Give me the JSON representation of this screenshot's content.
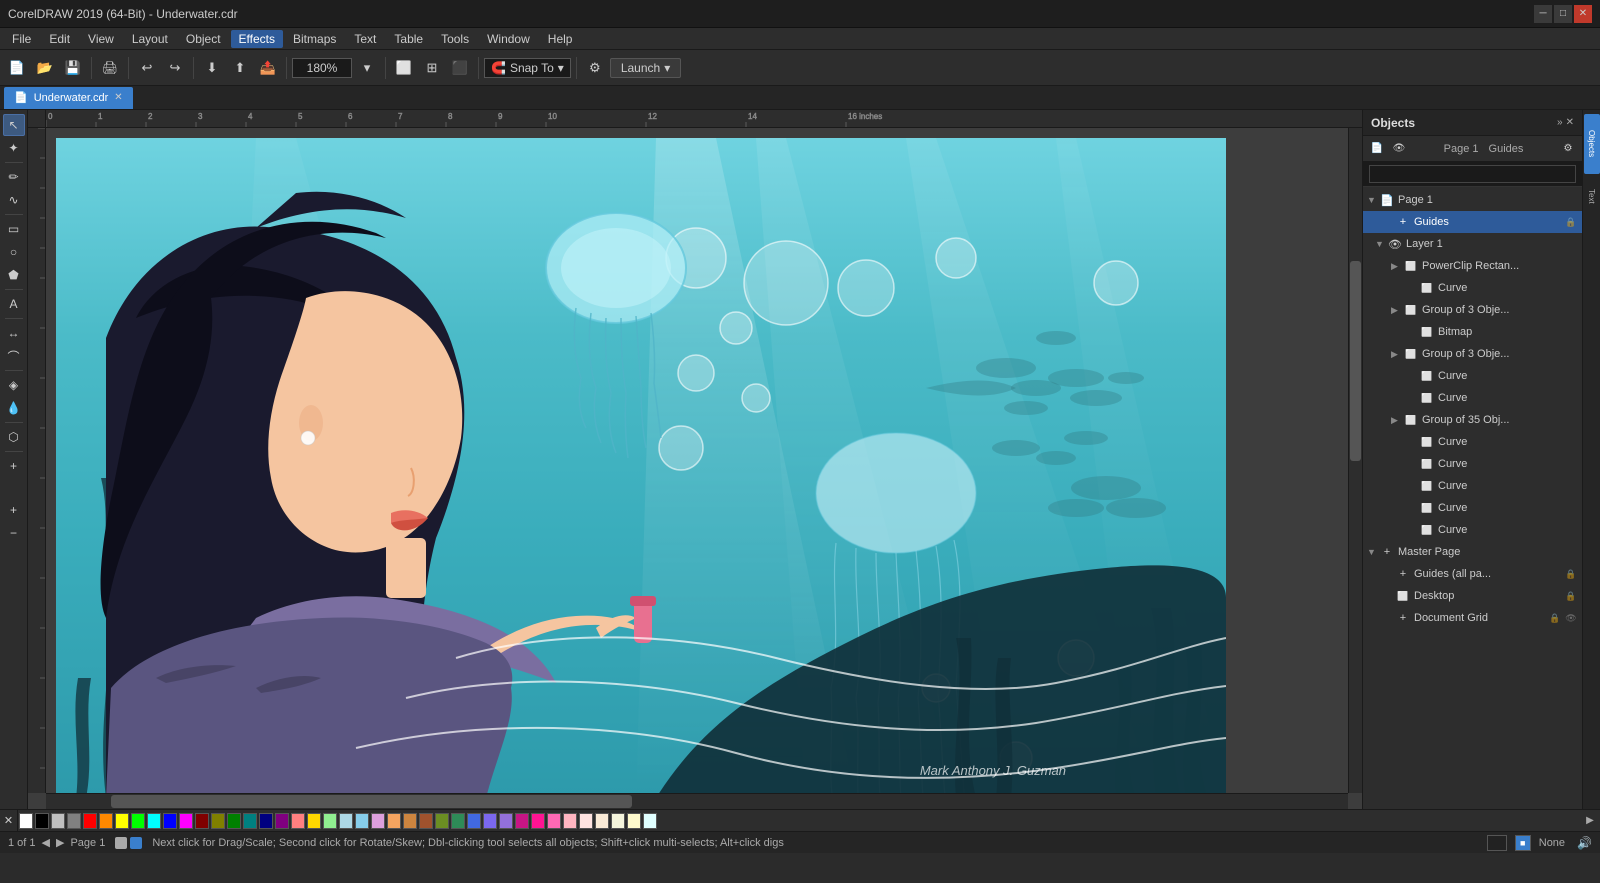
{
  "app": {
    "title": "CorelDRAW 2019 (64-Bit) - Underwater.cdr",
    "file": "Underwater.cdr"
  },
  "window_controls": {
    "minimize": "─",
    "maximize": "□",
    "close": "✕"
  },
  "menu": {
    "items": [
      "File",
      "Edit",
      "View",
      "Layout",
      "Object",
      "Effects",
      "Bitmaps",
      "Text",
      "Table",
      "Tools",
      "Window",
      "Help"
    ]
  },
  "toolbar": {
    "zoom_level": "180%",
    "snap_label": "Snap To",
    "launch_label": "Launch"
  },
  "doc_tab": {
    "label": "Underwater.cdr"
  },
  "canvas": {
    "attribution": "Mark Anthony J. Guzman"
  },
  "right_panel": {
    "title": "Objects",
    "search_placeholder": "",
    "tabs": [
      {
        "label": "Page 1"
      },
      {
        "label": "Guides"
      }
    ],
    "close_icon": "✕",
    "expand_icon": "»"
  },
  "objects_tree": {
    "items": [
      {
        "id": "page1",
        "label": "Page 1",
        "level": 0,
        "type": "page",
        "icon": "📄",
        "expanded": true
      },
      {
        "id": "guides",
        "label": "Guides",
        "level": 1,
        "type": "guides",
        "icon": "🔒",
        "selected": true,
        "lock_icon": "🔒"
      },
      {
        "id": "layer1",
        "label": "Layer 1",
        "level": 1,
        "type": "layer",
        "icon": "👁",
        "expanded": true
      },
      {
        "id": "powerclip",
        "label": "PowerClip Rectan...",
        "level": 2,
        "type": "object",
        "icon": "⬜",
        "expanded": false
      },
      {
        "id": "curve1",
        "label": "Curve",
        "level": 3,
        "type": "curve",
        "icon": "⬜"
      },
      {
        "id": "group3obj1",
        "label": "Group of 3 Obje...",
        "level": 2,
        "type": "group",
        "icon": "⬜",
        "expanded": false
      },
      {
        "id": "bitmap1",
        "label": "Bitmap",
        "level": 3,
        "type": "bitmap",
        "icon": "⬜"
      },
      {
        "id": "group3obj2",
        "label": "Group of 3 Obje...",
        "level": 2,
        "type": "group",
        "icon": "⬜",
        "expanded": false
      },
      {
        "id": "curve2",
        "label": "Curve",
        "level": 3,
        "type": "curve",
        "icon": "⬜"
      },
      {
        "id": "curve3",
        "label": "Curve",
        "level": 3,
        "type": "curve",
        "icon": "⬜"
      },
      {
        "id": "group35",
        "label": "Group of 35 Obj...",
        "level": 2,
        "type": "group",
        "icon": "⬜",
        "expanded": false
      },
      {
        "id": "curve4",
        "label": "Curve",
        "level": 3,
        "type": "curve",
        "icon": "⬜"
      },
      {
        "id": "curve5",
        "label": "Curve",
        "level": 3,
        "type": "curve",
        "icon": "⬜"
      },
      {
        "id": "curve6",
        "label": "Curve",
        "level": 3,
        "type": "curve",
        "icon": "⬜"
      },
      {
        "id": "curve7",
        "label": "Curve",
        "level": 3,
        "type": "curve",
        "icon": "⬜"
      },
      {
        "id": "curve8",
        "label": "Curve",
        "level": 3,
        "type": "curve",
        "icon": "⬜"
      },
      {
        "id": "masterpage",
        "label": "Master Page",
        "level": 0,
        "type": "masterpage",
        "icon": "📄",
        "expanded": true
      },
      {
        "id": "guides_all",
        "label": "Guides (all pa...",
        "level": 1,
        "type": "guides",
        "icon": "🔒",
        "lock_icon": "🔒"
      },
      {
        "id": "desktop",
        "label": "Desktop",
        "level": 1,
        "type": "layer",
        "icon": "⬜",
        "lock_icon": "🔒"
      },
      {
        "id": "docgrid",
        "label": "Document Grid",
        "level": 1,
        "type": "grid",
        "icon": "⊞",
        "lock_icon": "🔒"
      }
    ]
  },
  "color_palette": {
    "swatches": [
      "#ffffff",
      "#000000",
      "#ff0000",
      "#00ff00",
      "#0000ff",
      "#ffff00",
      "#ff00ff",
      "#00ffff",
      "#ff8800",
      "#8800ff",
      "#00ff88",
      "#ff0088",
      "#888888",
      "#444444",
      "#cc0000",
      "#00cc00",
      "#0000cc",
      "#cccc00",
      "#cc00cc",
      "#00cccc",
      "#884400",
      "#448800",
      "#004488",
      "#cc8800",
      "#8800cc",
      "#cc4400",
      "#4488cc",
      "#88cc00",
      "#cc0044",
      "#44cc88",
      "#0044cc",
      "#ff4400",
      "#44ff00",
      "#0044ff",
      "#ffaa00",
      "#aa00ff",
      "#00ffaa",
      "#ff00aa",
      "#aaaaaa",
      "#555555",
      "#ffcccc",
      "#ccffcc",
      "#ccccff",
      "#ffffcc",
      "#ffccff",
      "#ccffff"
    ]
  },
  "status_bar": {
    "page_info": "1 of 1",
    "page_label": "Page 1",
    "status_text": "Next click for Drag/Scale; Second click for Rotate/Skew; Dbl-clicking tool selects all objects; Shift+click multi-selects; Alt+click digs",
    "fill_label": "None",
    "lock_icon": "🔒"
  },
  "tools": {
    "items": [
      {
        "name": "pick-tool",
        "icon": "↖",
        "label": "Pick Tool"
      },
      {
        "name": "freehand-tool",
        "icon": "✏",
        "label": "Freehand Tool"
      },
      {
        "name": "smart-draw-tool",
        "icon": "⟋",
        "label": "Smart Drawing"
      },
      {
        "name": "rectangle-tool",
        "icon": "▭",
        "label": "Rectangle Tool"
      },
      {
        "name": "ellipse-tool",
        "icon": "○",
        "label": "Ellipse Tool"
      },
      {
        "name": "polygon-tool",
        "icon": "⬟",
        "label": "Polygon Tool"
      },
      {
        "name": "text-tool",
        "icon": "A",
        "label": "Text Tool"
      },
      {
        "name": "parallel-tool",
        "icon": "∥",
        "label": "Parallel Dimension"
      },
      {
        "name": "interactive-fill",
        "icon": "◈",
        "label": "Interactive Fill"
      },
      {
        "name": "eyedropper-tool",
        "icon": "💧",
        "label": "Eyedropper"
      },
      {
        "name": "smart-fill",
        "icon": "⬡",
        "label": "Smart Fill"
      },
      {
        "name": "add-node",
        "icon": "+",
        "label": "Add/Remove Node"
      }
    ]
  }
}
